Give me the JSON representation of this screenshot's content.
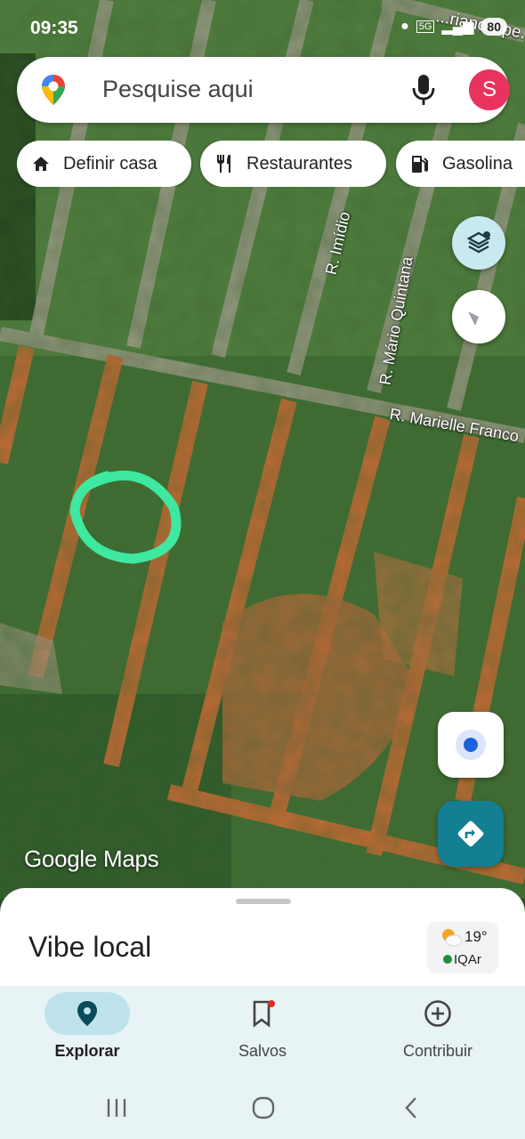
{
  "status_bar": {
    "time": "09:35",
    "battery": "80",
    "network": "5G"
  },
  "search": {
    "placeholder": "Pesquise aqui",
    "avatar_letter": "S"
  },
  "chips": [
    {
      "label": "Definir casa",
      "icon": "home-icon"
    },
    {
      "label": "Restaurantes",
      "icon": "fork-knife-icon"
    },
    {
      "label": "Gasolina",
      "icon": "gas-station-icon"
    }
  ],
  "map": {
    "streets": [
      "R. Imídio",
      "R. Mário Quintana",
      "R. Marielle Franco",
      "...riano Spe..."
    ],
    "logo_text": "Google Maps",
    "annotation_color": "#3ee8a0"
  },
  "sheet": {
    "title": "Vibe local",
    "temperature": "19°",
    "air_quality": "IQAr"
  },
  "nav": [
    {
      "label": "Explorar",
      "icon": "location-pin-icon",
      "active": true
    },
    {
      "label": "Salvos",
      "icon": "bookmark-icon",
      "active": false
    },
    {
      "label": "Contribuir",
      "icon": "plus-circle-icon",
      "active": false
    }
  ],
  "colors": {
    "accent": "#127f93",
    "avatar": "#e8335f",
    "nav_bg": "#e8f3f6"
  }
}
